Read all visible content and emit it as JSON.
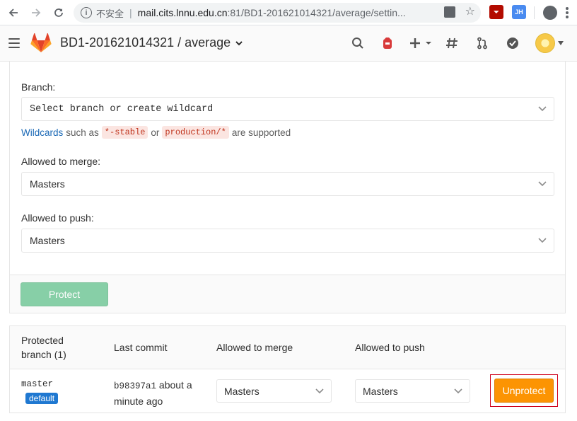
{
  "browser": {
    "insecure_label": "不安全",
    "url_host": "mail.cits.lnnu.edu.cn",
    "url_rest": ":81/BD1-201621014321/average/settin...",
    "ext_jh_label": "JH"
  },
  "header": {
    "breadcrumb": "BD1-201621014321 / average"
  },
  "form": {
    "branch_label": "Branch:",
    "branch_placeholder": "Select branch or create wildcard",
    "hint_link": "Wildcards",
    "hint_text1": "such as",
    "hint_code1": "*-stable",
    "hint_text2": "or",
    "hint_code2": "production/*",
    "hint_text3": "are supported",
    "merge_label": "Allowed to merge:",
    "merge_value": "Masters",
    "push_label": "Allowed to push:",
    "push_value": "Masters",
    "protect_button": "Protect"
  },
  "table": {
    "headers": {
      "branch_line1": "Protected",
      "branch_line2": "branch (1)",
      "last_commit": "Last commit",
      "allowed_merge": "Allowed to merge",
      "allowed_push": "Allowed to push"
    },
    "rows": [
      {
        "branch": "master",
        "badge": "default",
        "commit_sha": "b98397a1",
        "commit_time_1": "about a",
        "commit_time_2": "minute ago",
        "merge": "Masters",
        "push": "Masters",
        "action": "Unprotect"
      }
    ]
  },
  "colors": {
    "protect_button": "#3cb371",
    "unprotect_button": "#fc9403",
    "badge": "#1f78d1",
    "link": "#1b69b6",
    "highlight_border": "#d0021b"
  }
}
